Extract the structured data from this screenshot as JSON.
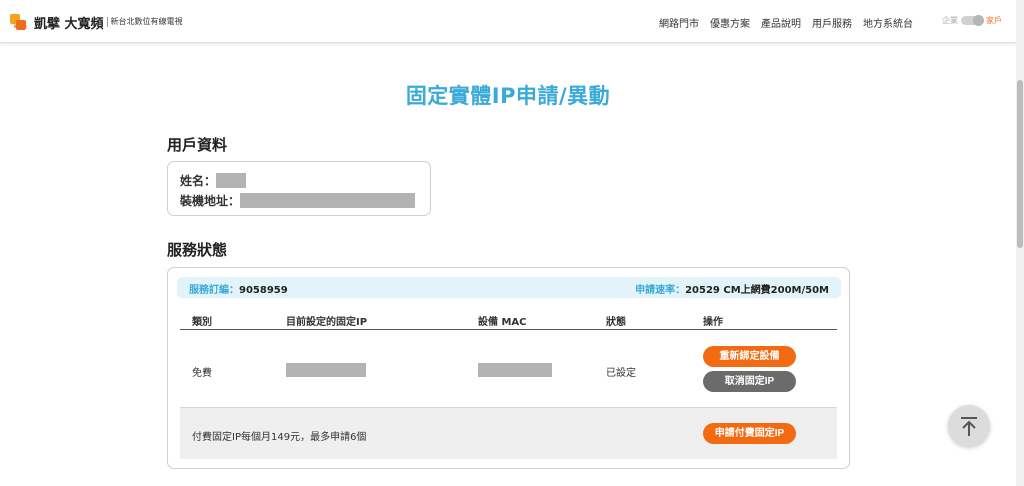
{
  "header": {
    "brand_name": "凱擘 大寬頻",
    "brand_sub": "新台北數位有線電視",
    "logo_tag": "kbro",
    "nav": [
      "網路門市",
      "優惠方案",
      "產品說明",
      "用戶服務",
      "地方系統台"
    ],
    "toggle": {
      "left_label": "企業",
      "right_label": "家戶",
      "selected": "家戶"
    }
  },
  "page": {
    "title": "固定實體IP申請/異動"
  },
  "user_section": {
    "title": "用戶資料",
    "name_label": "姓名：",
    "address_label": "裝機地址："
  },
  "service_section": {
    "title": "服務狀態",
    "order_label": "服務訂編：",
    "order_value": "9058959",
    "speed_label": "申請速率：",
    "speed_value": "20529 CM上網費200M/50M",
    "columns": [
      "類別",
      "目前設定的固定IP",
      "設備 MAC",
      "狀態",
      "操作"
    ],
    "rows": [
      {
        "type": "免費",
        "status": "已設定",
        "actions": [
          "重新綁定設備",
          "取消固定IP"
        ]
      }
    ],
    "paid_note": "付費固定IP每個月149元，最多申請6個",
    "paid_button": "申請付費固定IP"
  },
  "colors": {
    "accent_blue": "#3aaad8",
    "accent_orange": "#f26b13",
    "button_gray": "#6b6b6b"
  },
  "icons": {
    "back_to_top": "arrow-up-to-line-icon"
  }
}
